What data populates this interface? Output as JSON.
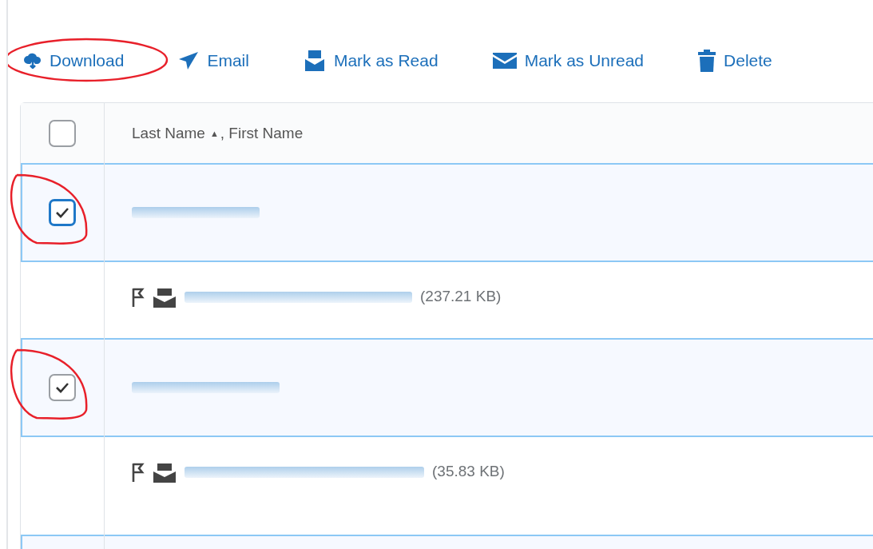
{
  "toolbar": [
    {
      "label": "Download",
      "annotated": true
    },
    {
      "label": "Email",
      "annotated": false
    },
    {
      "label": "Mark as Read",
      "annotated": false
    },
    {
      "label": "Mark as Unread",
      "annotated": false
    },
    {
      "label": "Delete",
      "annotated": false
    }
  ],
  "table": {
    "header": {
      "column_label": "Last Name",
      "sort_indicator": "▲",
      "column_label_2": ", First Name",
      "checked": false
    },
    "rows": [
      {
        "selected": true,
        "checked": true,
        "focused": true,
        "annotated": true,
        "file_size": "(237.21 KB)"
      },
      {
        "selected": true,
        "checked": true,
        "focused": false,
        "annotated": true,
        "file_size": "(35.83 KB)"
      }
    ]
  }
}
